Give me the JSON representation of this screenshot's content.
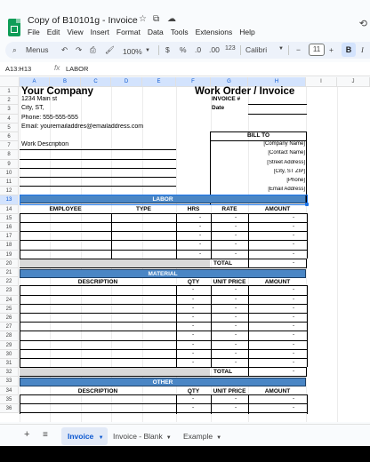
{
  "app": {
    "doc_title": "Copy of B10101g - Invoice",
    "menus": [
      "File",
      "Edit",
      "View",
      "Insert",
      "Format",
      "Data",
      "Tools",
      "Extensions",
      "Help"
    ]
  },
  "toolbar": {
    "search_menus": "Menus",
    "zoom": "100%",
    "currency": "$",
    "percent": "%",
    "decimal_dec": ".0",
    "decimal_inc": ".00",
    "number_format": "123",
    "font": "Calibri",
    "font_size": "11",
    "bold": "B"
  },
  "formula_bar": {
    "name_box": "A13:H13",
    "fx": "fx",
    "formula": "LABOR"
  },
  "columns": [
    "A",
    "B",
    "C",
    "D",
    "E",
    "F",
    "G",
    "H",
    "I",
    "J"
  ],
  "rows": [
    "1",
    "2",
    "3",
    "4",
    "5",
    "6",
    "7",
    "8",
    "9",
    "10",
    "11",
    "12",
    "13",
    "14",
    "15",
    "16",
    "17",
    "18",
    "19",
    "20",
    "21",
    "22",
    "23",
    "24",
    "25",
    "26",
    "27",
    "28",
    "29",
    "30",
    "31",
    "32",
    "33",
    "34",
    "35",
    "36"
  ],
  "sheet": {
    "company": "Your Company",
    "address1": "1234 Main st",
    "address2": "City, ST,",
    "phone": "Phone: 555-555-555",
    "email": "Email:  youremailaddres@emailaddress.com",
    "title": "Work Order / Invoice",
    "invoice_label": "INVOICE #",
    "date_label": "Date",
    "bill_to": "BILL TO",
    "bill_lines": [
      "[Company Name]",
      "[Contact Name]",
      "[Street Address]",
      "[City, ST  ZIP]",
      "[Phone]",
      "[Email Address]"
    ],
    "work_description": "Work Description",
    "labor": {
      "title": "LABOR",
      "headers": [
        "EMPLOYEE",
        "TYPE",
        "HRS",
        "RATE",
        "AMOUNT"
      ],
      "dash": "-",
      "total": "TOTAL"
    },
    "material": {
      "title": "MATERIAL",
      "headers": [
        "DESCRIPTION",
        "QTY",
        "UNIT PRICE",
        "AMOUNT"
      ],
      "dash": "-",
      "total": "TOTAL"
    },
    "other": {
      "title": "OTHER",
      "headers": [
        "DESCRIPTION",
        "QTY",
        "UNIT PRICE",
        "AMOUNT"
      ],
      "dash": "-"
    }
  },
  "tabs": {
    "add": "+",
    "list": "≡",
    "sheets": [
      "Invoice",
      "Invoice - Blank",
      "Example"
    ]
  }
}
